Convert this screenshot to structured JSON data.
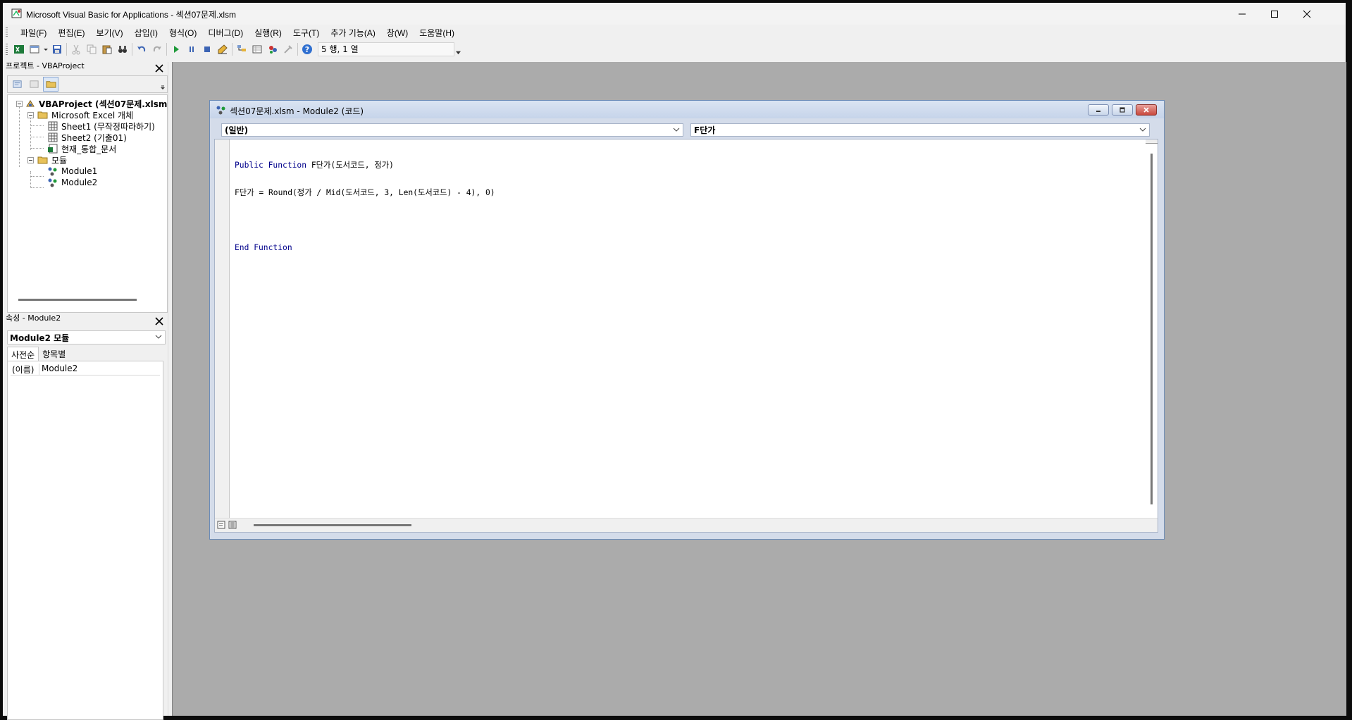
{
  "window": {
    "title": "Microsoft Visual Basic for Applications - 섹션07문제.xlsm"
  },
  "menu": [
    "파일(F)",
    "편집(E)",
    "보기(V)",
    "삽입(I)",
    "형식(O)",
    "디버그(D)",
    "실행(R)",
    "도구(T)",
    "추가 기능(A)",
    "창(W)",
    "도움말(H)"
  ],
  "toolbar": {
    "cursor_position": "5 행, 1 열"
  },
  "project_panel": {
    "title": "프로젝트 - VBAProject",
    "tree": {
      "root": "VBAProject (섹션07문제.xlsm)",
      "excel_objects_folder": "Microsoft Excel 개체",
      "sheet1": "Sheet1 (무작정따라하기)",
      "sheet2": "Sheet2 (기출01)",
      "workbook": "현재_통합_문서",
      "modules_folder": "모듈",
      "module1": "Module1",
      "module2": "Module2"
    }
  },
  "properties_panel": {
    "title": "속성 - Module2",
    "object_combo": "Module2 모듈",
    "tabs": [
      "사전순",
      "항목별"
    ],
    "property_name": "(이름)",
    "property_value": "Module2"
  },
  "code_window": {
    "title": "섹션07문제.xlsm - Module2 (코드)",
    "object_combo": "(일반)",
    "procedure_combo": "F단가",
    "lines": {
      "line1_keyword": "Public Function",
      "line1_rest": " F단가(도서코드, 정가)",
      "line2": "F단가 = Round(정가 / Mid(도서코드, 3, Len(도서코드) - 4), 0)",
      "line4": "End Function"
    }
  },
  "colors": {
    "mdi_background": "#ababab",
    "code_keyword": "#00008b",
    "titlebar_gradient": "#c6d4ea"
  }
}
